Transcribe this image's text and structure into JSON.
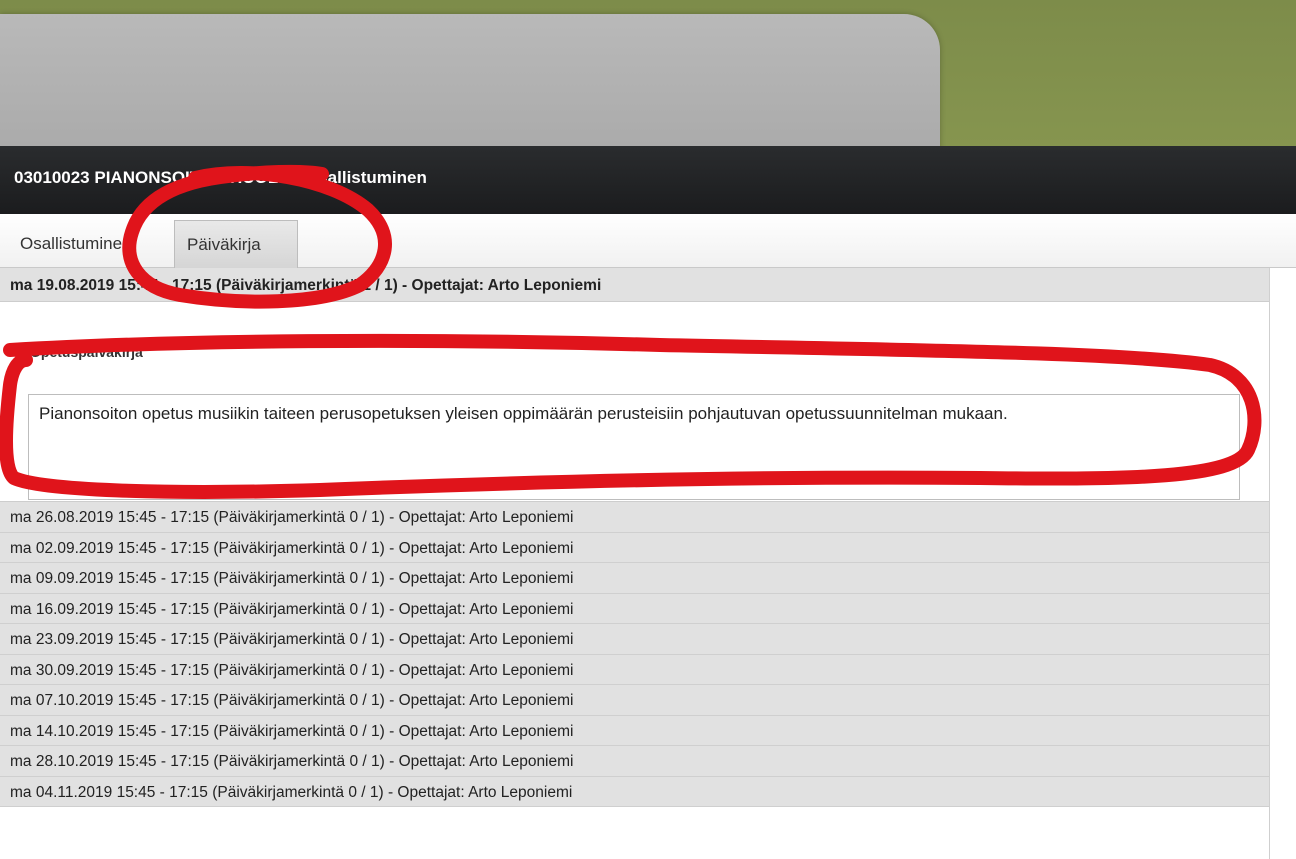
{
  "header": {
    "title": "03010023 PIANONSOITON HUOLTO Osallistuminen"
  },
  "tabs": [
    {
      "label": "Osallistuminen"
    },
    {
      "label": "Päiväkirja"
    }
  ],
  "open_entry": {
    "heading": "ma 19.08.2019 15:45 - 17:15 (Päiväkirjamerkintä 1 / 1) - Opettajat: Arto Leponiemi",
    "label": "Opetuspäiväkirja",
    "text": "Pianonsoiton opetus musiikin taiteen perusopetuksen yleisen oppimäärän perusteisiin pohjautuvan opetussuunnitelman mukaan."
  },
  "entries": [
    {
      "label": "ma 26.08.2019 15:45 - 17:15 (Päiväkirjamerkintä 0 / 1) - Opettajat: Arto Leponiemi"
    },
    {
      "label": "ma 02.09.2019 15:45 - 17:15 (Päiväkirjamerkintä 0 / 1) - Opettajat: Arto Leponiemi"
    },
    {
      "label": "ma 09.09.2019 15:45 - 17:15 (Päiväkirjamerkintä 0 / 1) - Opettajat: Arto Leponiemi"
    },
    {
      "label": "ma 16.09.2019 15:45 - 17:15 (Päiväkirjamerkintä 0 / 1) - Opettajat: Arto Leponiemi"
    },
    {
      "label": "ma 23.09.2019 15:45 - 17:15 (Päiväkirjamerkintä 0 / 1) - Opettajat: Arto Leponiemi"
    },
    {
      "label": "ma 30.09.2019 15:45 - 17:15 (Päiväkirjamerkintä 0 / 1) - Opettajat: Arto Leponiemi"
    },
    {
      "label": "ma 07.10.2019 15:45 - 17:15 (Päiväkirjamerkintä 0 / 1) - Opettajat: Arto Leponiemi"
    },
    {
      "label": "ma 14.10.2019 15:45 - 17:15 (Päiväkirjamerkintä 0 / 1) - Opettajat: Arto Leponiemi"
    },
    {
      "label": "ma 28.10.2019 15:45 - 17:15 (Päiväkirjamerkintä 0 / 1) - Opettajat: Arto Leponiemi"
    },
    {
      "label": "ma 04.11.2019 15:45 - 17:15 (Päiväkirjamerkintä 0 / 1) - Opettajat: Arto Leponiemi"
    }
  ],
  "colors": {
    "olive_band": "#83924d",
    "title_bar": "#1f2022",
    "row_bg": "#e1e1e1",
    "annotation_red": "#e0141b"
  }
}
